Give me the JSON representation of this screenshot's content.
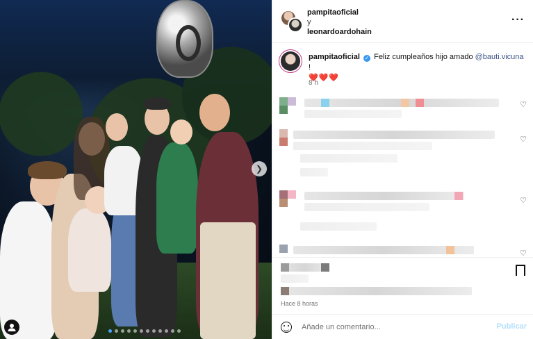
{
  "header": {
    "user1": "pampitaoficial",
    "joiner": "y",
    "user2": "leonardoardohain",
    "more_icon": "more-horizontal-icon"
  },
  "caption": {
    "username": "pampitaoficial",
    "text": "Feliz cumpleaños hijo amado",
    "mention": "@bauti.vicuna",
    "exclaim": "!",
    "hearts": "❤️❤️❤️",
    "time": "8 h"
  },
  "feed": {
    "timestamp": "Hace 8 horas"
  },
  "comment_box": {
    "placeholder": "Añade un comentario...",
    "publish_label": "Publicar"
  },
  "colors": {
    "mention": "#385185",
    "publish_disabled": "#b2dffc",
    "verified": "#3897f0"
  }
}
